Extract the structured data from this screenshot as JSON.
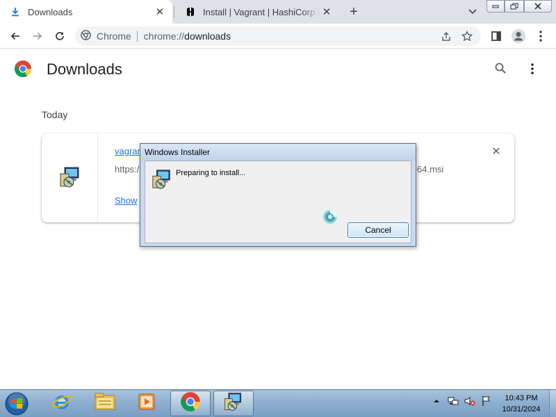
{
  "browser": {
    "tabs": [
      {
        "label": "Downloads",
        "icon": "download-icon",
        "active": true
      },
      {
        "label": "Install | Vagrant | HashiCorp Developer",
        "icon": "hashicorp-icon",
        "active": false
      }
    ],
    "omnibox": {
      "site_label": "Chrome",
      "url_scheme": "chrome://",
      "url_host": "downloads"
    }
  },
  "page": {
    "title": "Downloads",
    "section_label": "Today",
    "download": {
      "filename": "vagrant_2.4.1_windows_amd64.msi",
      "filename_visible": "vagrar",
      "url_visible_start": "https:/",
      "url_visible_end": "64.msi",
      "show_in_folder": "Show"
    }
  },
  "dialog": {
    "title": "Windows Installer",
    "message": "Preparing to install...",
    "cancel_label": "Cancel"
  },
  "taskbar": {
    "clock_time": "10:43 PM",
    "clock_date": "10/31/2024"
  },
  "colors": {
    "link": "#1a73e8",
    "taskbar": "#8eafcf",
    "dialog_frame": "#c9daf0"
  }
}
